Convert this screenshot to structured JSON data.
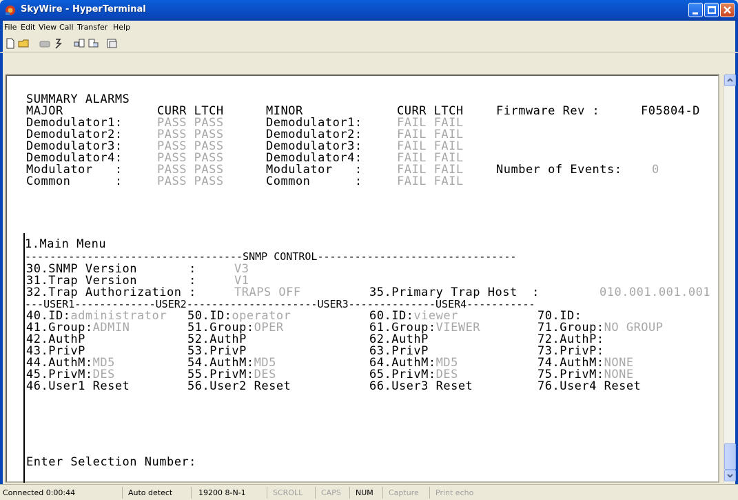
{
  "window": {
    "title": "SkyWire - HyperTerminal"
  },
  "menu": [
    "File",
    "Edit",
    "View",
    "Call",
    "Transfer",
    "Help"
  ],
  "toolbar": [
    "new-icon",
    "open-icon",
    "disconnect-icon",
    "dial-icon",
    "send-icon",
    "receive-icon",
    "properties-icon"
  ],
  "terminal": {
    "summary_title": "SUMMARY ALARMS",
    "major_header": "MAJOR",
    "minor_header": "MINOR",
    "curr_ltch": "CURR LTCH",
    "firmware_label": "Firmware Rev :",
    "firmware_value": "F05804-D",
    "events_label": "Number of Events:",
    "events_value": "0",
    "alarm_rows": [
      {
        "label": "Demodulator1:",
        "major": "PASS PASS",
        "minor": "FAIL FAIL"
      },
      {
        "label": "Demodulator2:",
        "major": "PASS PASS",
        "minor": "FAIL FAIL"
      },
      {
        "label": "Demodulator3:",
        "major": "PASS PASS",
        "minor": "FAIL FAIL"
      },
      {
        "label": "Demodulator4:",
        "major": "PASS PASS",
        "minor": "FAIL FAIL"
      },
      {
        "label": "Modulator   :",
        "major": "PASS PASS",
        "minor": "FAIL FAIL"
      },
      {
        "label": "Common      :",
        "major": "PASS PASS",
        "minor": "FAIL FAIL"
      }
    ],
    "main_menu": "1.Main Menu",
    "snmp_divider": "-----------------------------------SNMP CONTROL--------------------------------",
    "snmp_version_label": "30.SNMP Version       :",
    "snmp_version_value": "V3",
    "trap_version_label": "31.Trap Version       :",
    "trap_version_value": "V1",
    "trap_auth_label": "32.Trap Authorization :",
    "trap_auth_value": "TRAPS OFF",
    "primary_trap_label": "35.Primary Trap Host  :",
    "primary_trap_value": "010.001.001.001",
    "user_divider": "---USER1-------------USER2---------------------USER3--------------USER4-----------",
    "users": [
      {
        "id_label": "40.ID:",
        "id": "administrator",
        "group_label": "41.Group:",
        "group": "ADMIN",
        "authp": "42.AuthP",
        "privp": "43.PrivP",
        "authm_label": "44.AuthM:",
        "authm": "MD5",
        "privm_label": "45.PrivM:",
        "privm": "DES",
        "reset": "46.User1 Reset"
      },
      {
        "id_label": "50.ID:",
        "id": "operator",
        "group_label": "51.Group:",
        "group": "OPER",
        "authp": "52.AuthP",
        "privp": "53.PrivP",
        "authm_label": "54.AuthM:",
        "authm": "MD5",
        "privm_label": "55.PrivM:",
        "privm": "DES",
        "reset": "56.User2 Reset"
      },
      {
        "id_label": "60.ID:",
        "id": "viewer",
        "group_label": "61.Group:",
        "group": "VIEWER",
        "authp": "62.AuthP",
        "privp": "63.PrivP",
        "authm_label": "64.AuthM:",
        "authm": "MD5",
        "privm_label": "65.PrivM:",
        "privm": "DES",
        "reset": "66.User3 Reset"
      },
      {
        "id_label": "70.ID:",
        "id": "",
        "group_label": "71.Group:",
        "group": "NO GROUP",
        "authp": "72.AuthP:",
        "privp": "73.PrivP:",
        "authm_label": "74.AuthM:",
        "authm": "NONE",
        "privm_label": "75.PrivM:",
        "privm": "NONE",
        "reset": "76.User4 Reset"
      }
    ],
    "prompt": "Enter Selection Number:"
  },
  "status": {
    "connected": "Connected 0:00:44",
    "detect": "Auto detect",
    "port": "19200 8-N-1",
    "scroll": "SCROLL",
    "caps": "CAPS",
    "num": "NUM",
    "capture": "Capture",
    "print_echo": "Print echo"
  }
}
